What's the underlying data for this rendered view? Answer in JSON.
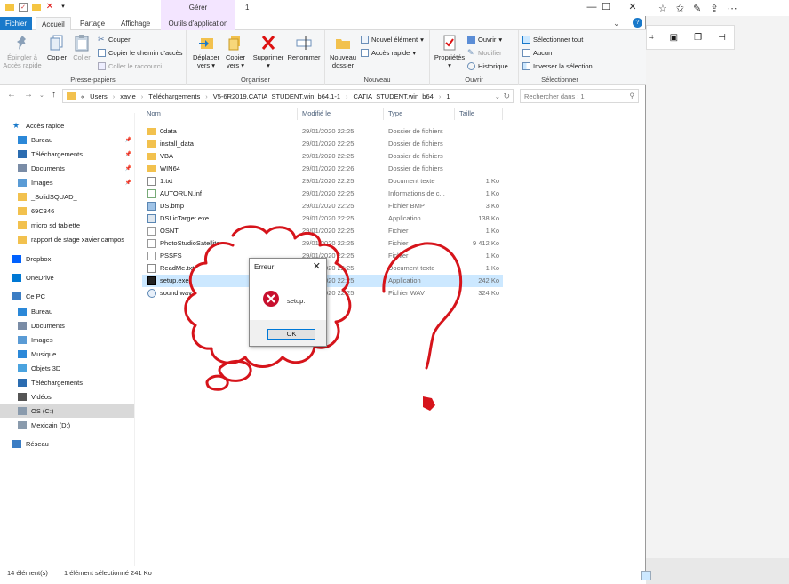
{
  "window": {
    "context_tab_band": "Gérer",
    "title": "1",
    "controls": [
      "—",
      "☐",
      "✕"
    ]
  },
  "tabs": [
    "Fichier",
    "Accueil",
    "Partage",
    "Affichage",
    "Outils d'application"
  ],
  "ribbon": {
    "presse_papiers": {
      "group_label": "Presse-papiers",
      "pin": "Épingler à Accès rapide",
      "copy": "Copier",
      "paste": "Coller",
      "cut": "Couper",
      "copy_path": "Copier le chemin d'accès",
      "paste_shortcut": "Coller le raccourci"
    },
    "organiser": {
      "group_label": "Organiser",
      "move_to": "Déplacer vers",
      "copy_to": "Copier vers",
      "delete": "Supprimer",
      "rename": "Renommer"
    },
    "nouveau": {
      "group_label": "Nouveau",
      "new_folder": "Nouveau dossier",
      "new_item": "Nouvel élément",
      "easy_access": "Accès rapide"
    },
    "ouvrir": {
      "group_label": "Ouvrir",
      "properties": "Propriétés",
      "open": "Ouvrir",
      "edit": "Modifier",
      "history": "Historique"
    },
    "selectionner": {
      "group_label": "Sélectionner",
      "select_all": "Sélectionner tout",
      "select_none": "Aucun",
      "invert": "Inverser la sélection"
    }
  },
  "address": {
    "path": [
      "«",
      "Users",
      "xavie",
      "Téléchargements",
      "V5-6R2019.CATIA_STUDENT.win_b64.1-1",
      "CATIA_STUDENT.win_b64",
      "1"
    ],
    "search_placeholder": "Rechercher dans : 1"
  },
  "nav": {
    "items": [
      {
        "label": "Accès rapide",
        "icon": "star-icon",
        "pinned": false
      },
      {
        "label": "Bureau",
        "icon": "desktop-icon",
        "pinned": true
      },
      {
        "label": "Téléchargements",
        "icon": "download-icon",
        "pinned": true
      },
      {
        "label": "Documents",
        "icon": "documents-icon",
        "pinned": true
      },
      {
        "label": "Images",
        "icon": "images-icon",
        "pinned": true
      },
      {
        "label": "_SolidSQUAD_",
        "icon": "folder-icon",
        "pinned": false
      },
      {
        "label": "69C346",
        "icon": "folder-icon",
        "pinned": false
      },
      {
        "label": "micro sd tablette",
        "icon": "folder-icon",
        "pinned": false
      },
      {
        "label": "rapport de stage xavier campos",
        "icon": "folder-icon",
        "pinned": false
      },
      {
        "label": "Dropbox",
        "icon": "dropbox-icon",
        "pinned": false
      },
      {
        "label": "OneDrive",
        "icon": "onedrive-icon",
        "pinned": false
      },
      {
        "label": "Ce PC",
        "icon": "pc-icon",
        "pinned": false
      },
      {
        "label": "Bureau",
        "icon": "desktop-icon",
        "pinned": false
      },
      {
        "label": "Documents",
        "icon": "documents-icon",
        "pinned": false
      },
      {
        "label": "Images",
        "icon": "images-icon",
        "pinned": false
      },
      {
        "label": "Musique",
        "icon": "music-icon",
        "pinned": false
      },
      {
        "label": "Objets 3D",
        "icon": "3d-objects-icon",
        "pinned": false
      },
      {
        "label": "Téléchargements",
        "icon": "download-icon",
        "pinned": false
      },
      {
        "label": "Vidéos",
        "icon": "videos-icon",
        "pinned": false
      },
      {
        "label": "OS (C:)",
        "icon": "drive-icon",
        "pinned": false,
        "selected": true
      },
      {
        "label": "Mexicain (D:)",
        "icon": "drive-icon",
        "pinned": false
      },
      {
        "label": "Réseau",
        "icon": "network-icon",
        "pinned": false
      }
    ]
  },
  "columns": {
    "name": "Nom",
    "date": "Modifié le",
    "type": "Type",
    "size": "Taille"
  },
  "files": [
    {
      "name": "0data",
      "date": "29/01/2020 22:25",
      "type": "Dossier de fichiers",
      "size": "",
      "icon": "folder-icon"
    },
    {
      "name": "install_data",
      "date": "29/01/2020 22:25",
      "type": "Dossier de fichiers",
      "size": "",
      "icon": "folder-icon"
    },
    {
      "name": "VBA",
      "date": "29/01/2020 22:25",
      "type": "Dossier de fichiers",
      "size": "",
      "icon": "folder-icon"
    },
    {
      "name": "WIN64",
      "date": "29/01/2020 22:26",
      "type": "Dossier de fichiers",
      "size": "",
      "icon": "folder-icon"
    },
    {
      "name": "1.txt",
      "date": "29/01/2020 22:25",
      "type": "Document texte",
      "size": "1 Ko",
      "icon": "text-file-icon"
    },
    {
      "name": "AUTORUN.inf",
      "date": "29/01/2020 22:25",
      "type": "Informations de c...",
      "size": "1 Ko",
      "icon": "inf-file-icon"
    },
    {
      "name": "DS.bmp",
      "date": "29/01/2020 22:25",
      "type": "Fichier BMP",
      "size": "3 Ko",
      "icon": "image-file-icon"
    },
    {
      "name": "DSLicTarget.exe",
      "date": "29/01/2020 22:25",
      "type": "Application",
      "size": "138 Ko",
      "icon": "exe-file-icon"
    },
    {
      "name": "OSNT",
      "date": "29/01/2020 22:25",
      "type": "Fichier",
      "size": "1 Ko",
      "icon": "blank-file-icon"
    },
    {
      "name": "PhotoStudioSatellite",
      "date": "29/01/2020 22:25",
      "type": "Fichier",
      "size": "9 412 Ko",
      "icon": "blank-file-icon"
    },
    {
      "name": "PSSFS",
      "date": "29/01/2020 22:25",
      "type": "Fichier",
      "size": "1 Ko",
      "icon": "blank-file-icon"
    },
    {
      "name": "ReadMe.txt",
      "date": "29/01/2020 22:25",
      "type": "Document texte",
      "size": "1 Ko",
      "icon": "text-file-icon"
    },
    {
      "name": "setup.exe",
      "date": "29/01/2020 22:25",
      "type": "Application",
      "size": "242 Ko",
      "icon": "setup-exe-icon",
      "selected": true
    },
    {
      "name": "sound.wav",
      "date": "29/01/2020 22:25",
      "type": "Fichier WAV",
      "size": "324 Ko",
      "icon": "audio-file-icon"
    }
  ],
  "status": {
    "count": "14 élément(s)",
    "selection": "1 élément sélectionné  241 Ko"
  },
  "dialog": {
    "title": "Erreur",
    "message": "setup:",
    "ok": "OK"
  },
  "colors": {
    "accent": "#1979ca",
    "selection": "#cce8ff",
    "ink": "#d6141b",
    "error": "#c8102e"
  }
}
